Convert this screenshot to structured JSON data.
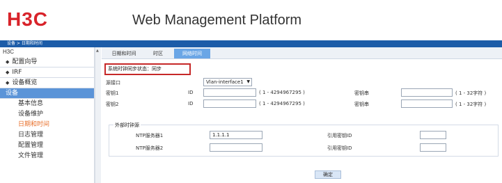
{
  "header": {
    "logo": "H3C",
    "title": "Web Management Platform",
    "breadcrumb": "设备 > 日期和时间"
  },
  "sidebar": {
    "root": "H3C",
    "items": [
      {
        "label": "配置向导",
        "type": "section"
      },
      {
        "label": "IRF",
        "type": "section"
      },
      {
        "label": "设备概览",
        "type": "section"
      },
      {
        "label": "设备",
        "type": "active"
      }
    ],
    "subitems": [
      {
        "label": "基本信息"
      },
      {
        "label": "设备维护"
      },
      {
        "label": "日期和时间"
      },
      {
        "label": "日志管理"
      },
      {
        "label": "配置管理"
      },
      {
        "label": "文件管理"
      }
    ]
  },
  "tabs": [
    {
      "label": "日期和时间"
    },
    {
      "label": "时区"
    },
    {
      "label": "网络时间"
    }
  ],
  "form": {
    "sync_status": "系统时钟同步状态：同步",
    "source_interface_label": "源接口",
    "source_interface_value": "Vlan-interface1",
    "key1_label": "密钥1",
    "key2_label": "密钥2",
    "id_label": "ID",
    "id_range": "( 1 - 4294967295 )",
    "key_string_label": "密钥串",
    "key_string_range": "( 1 - 32字符 )",
    "external_source_legend": "外部时钟源",
    "ntp_server1_label": "NTP服务器1",
    "ntp_server1_value": "1.1.1.1",
    "ntp_server2_label": "NTP服务器2",
    "ntp_server2_value": "",
    "ref_key_id_label": "引用密钥ID",
    "confirm_button": "确定"
  }
}
